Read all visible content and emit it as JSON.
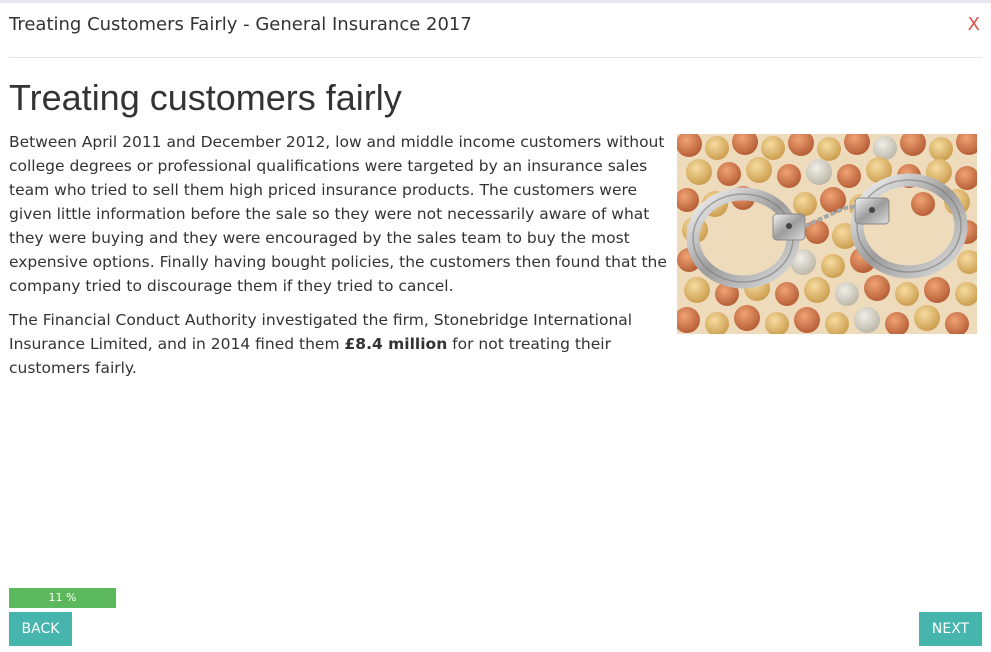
{
  "header": {
    "title": "Treating Customers Fairly - General Insurance 2017",
    "close_label": "X"
  },
  "main": {
    "heading": "Treating customers fairly",
    "paragraph1": "Between April 2011 and December 2012, low and middle income customers without college degrees or professional qualifications were targeted by an insurance sales team who tried to sell them high priced insurance products. The customers were given little information before the sale so they were not necessarily aware of what they were buying and they were encouraged by the sales team to buy the most expensive options. Finally having bought policies,  the customers then found that the company tried to discourage them if they tried to cancel.",
    "paragraph2_before": "The Financial Conduct Authority investigated the firm, Stonebridge International Insurance Limited, and in 2014 fined them ",
    "paragraph2_bold": "£8.4 million",
    "paragraph2_after": " for not treating their customers fairly.",
    "image": {
      "icon": "handcuffs-on-coins-image"
    }
  },
  "footer": {
    "progress_text": "11 %",
    "progress_value": 0.11,
    "back_label": "BACK",
    "next_label": "NEXT"
  },
  "colors": {
    "accent": "#45b5ad",
    "progress": "#5cb85c",
    "close": "#d9534f"
  }
}
